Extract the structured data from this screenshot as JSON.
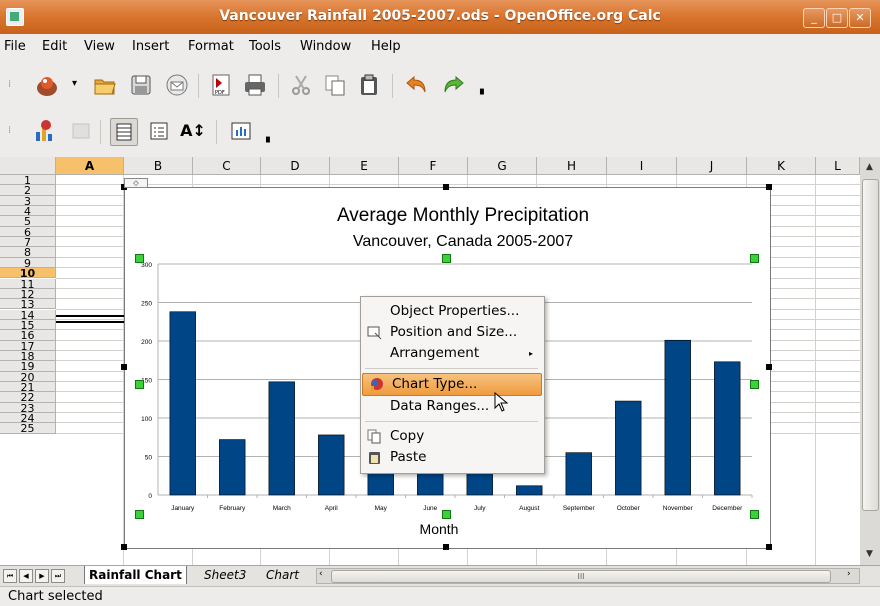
{
  "window": {
    "title": "Vancouver Rainfall 2005-2007.ods - OpenOffice.org Calc",
    "buttons": [
      "minimize",
      "maximize",
      "close"
    ]
  },
  "menu": {
    "items": [
      {
        "label": "File"
      },
      {
        "label": "Edit"
      },
      {
        "label": "View"
      },
      {
        "label": "Insert"
      },
      {
        "label": "Format"
      },
      {
        "label": "Tools"
      },
      {
        "label": "Window"
      },
      {
        "label": "Help"
      }
    ]
  },
  "toolbar1": {
    "icons": [
      "chart-app-icon",
      "dropdown-arrow-icon",
      "open-folder-icon",
      "save-icon",
      "email-icon",
      "export-pdf-icon",
      "print-icon",
      "cut-icon",
      "copy-icon",
      "paste-icon",
      "undo-icon",
      "redo-icon",
      "toolbar-options-icon"
    ]
  },
  "toolbar2": {
    "icons": [
      "chart-type-icon",
      "data-table-icon",
      "horizontal-grids-icon",
      "legend-icon",
      "scale-text-icon",
      "automatic-layout-icon",
      "toolbar-options-icon"
    ]
  },
  "grid": {
    "columns": [
      "A",
      "B",
      "C",
      "D",
      "E",
      "F",
      "G",
      "H",
      "I",
      "J",
      "K",
      "L"
    ],
    "rows": [
      "1",
      "2",
      "3",
      "4",
      "5",
      "6",
      "7",
      "8",
      "9",
      "10",
      "11",
      "12",
      "13",
      "14",
      "15",
      "16",
      "17",
      "18",
      "19",
      "20",
      "21",
      "22",
      "23",
      "24",
      "25"
    ],
    "active_column": "A",
    "active_row": "10"
  },
  "sheet_tabs": {
    "tabs": [
      {
        "label": "Rainfall Chart",
        "active": true
      },
      {
        "label": "Sheet3",
        "active": false
      },
      {
        "label": "Chart",
        "active": false
      }
    ]
  },
  "status": {
    "text": "Chart selected"
  },
  "context_menu": {
    "items": [
      {
        "label": "Object Properties...",
        "icon": ""
      },
      {
        "label": "Position and Size...",
        "icon": "position-size-icon"
      },
      {
        "label": "Arrangement",
        "icon": "",
        "submenu": true
      },
      {
        "label": "Chart Type...",
        "icon": "chart-type-icon",
        "highlighted": true
      },
      {
        "label": "Data Ranges...",
        "icon": ""
      },
      {
        "label": "Copy",
        "icon": "copy-icon"
      },
      {
        "label": "Paste",
        "icon": "paste-icon"
      }
    ]
  },
  "chart_data": {
    "type": "bar",
    "title": "Average Monthly Precipitation",
    "subtitle": "Vancouver, Canada 2005-2007",
    "xlabel": "Month",
    "ylabel": "",
    "ylim": [
      0,
      300
    ],
    "yticks": [
      0,
      50,
      100,
      150,
      200,
      250,
      300
    ],
    "categories": [
      "January",
      "February",
      "March",
      "April",
      "May",
      "June",
      "July",
      "August",
      "September",
      "October",
      "November",
      "December"
    ],
    "values": [
      238,
      72,
      147,
      78,
      62,
      65,
      55,
      12,
      55,
      122,
      201,
      173
    ],
    "bar_color": "#004586",
    "grid": true,
    "legend": "none"
  }
}
